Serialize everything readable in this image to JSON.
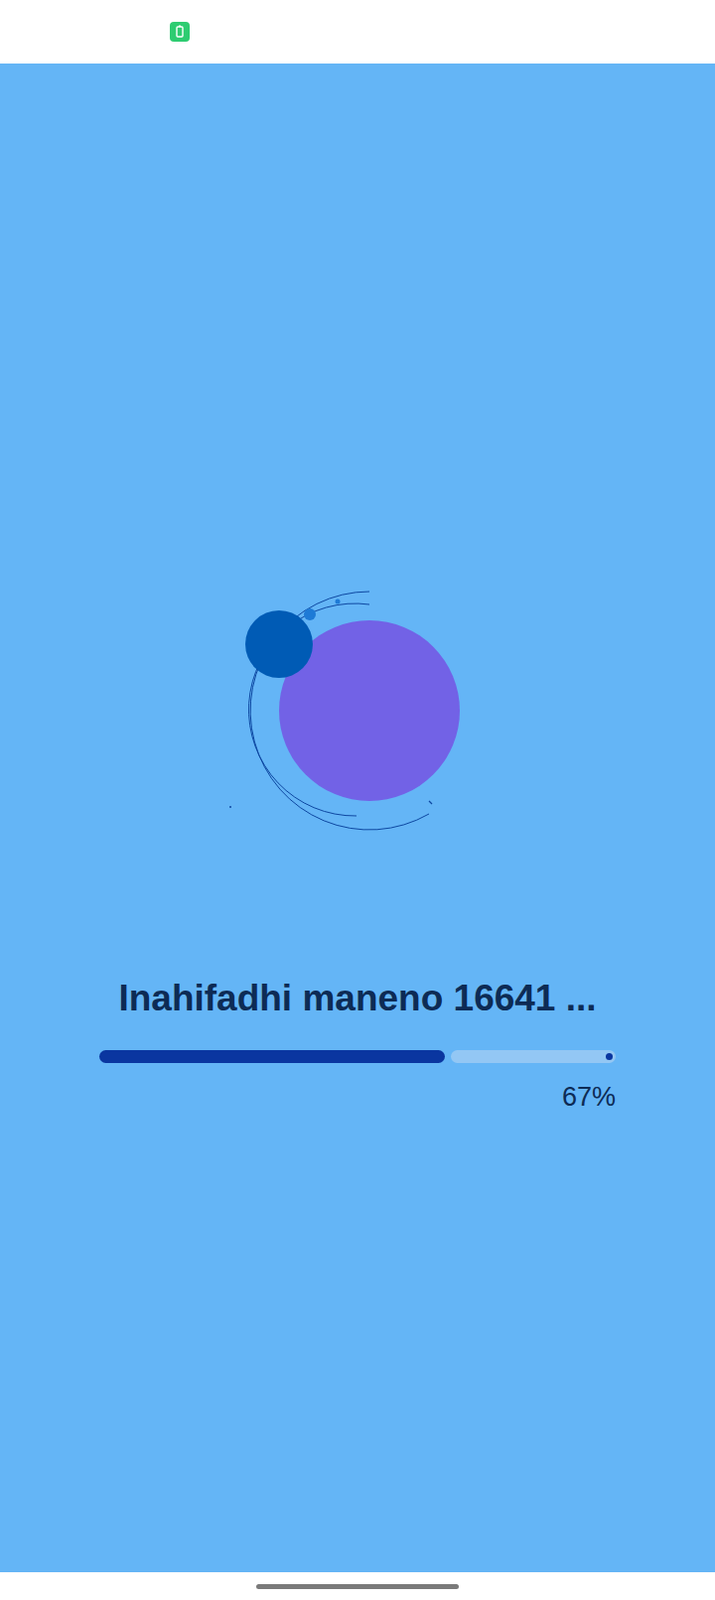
{
  "status": "Inahifadhi maneno 16641 ...",
  "progress": {
    "level": 0.67,
    "reading": "67%"
  }
}
